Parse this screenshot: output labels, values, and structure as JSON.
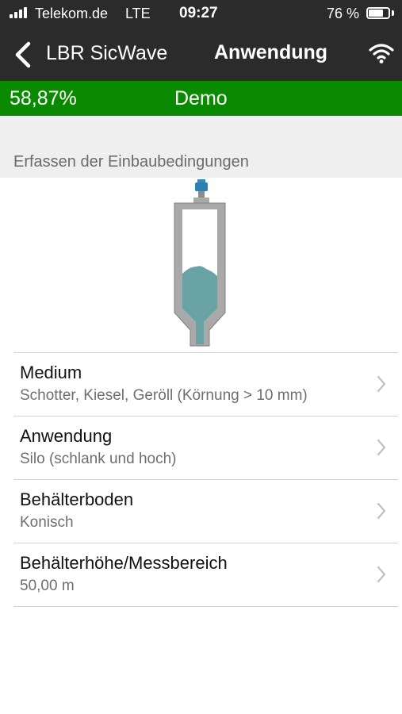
{
  "status_bar": {
    "carrier": "Telekom.de",
    "network": "LTE",
    "time": "09:27",
    "battery_percent": "76 %",
    "battery_level": 0.76
  },
  "nav": {
    "back_label": "LBR SicWave",
    "title": "Anwendung",
    "back_icon": "chevron-left-icon",
    "connection_icon": "wifi-icon"
  },
  "progress": {
    "value": "58,87%",
    "mode": "Demo",
    "color": "#0a8a00"
  },
  "section": {
    "title": "Erfassen der Einbaubedingungen"
  },
  "silo": {
    "fill_color": "#6aa3a6",
    "wall_color": "#a9a9a9"
  },
  "settings": [
    {
      "title": "Medium",
      "value": "Schotter, Kiesel, Geröll (Körnung > 10 mm)"
    },
    {
      "title": "Anwendung",
      "value": "Silo (schlank und hoch)"
    },
    {
      "title": "Behälterboden",
      "value": "Konisch"
    },
    {
      "title": "Behälterhöhe/Messbereich",
      "value": "50,00 m"
    }
  ]
}
